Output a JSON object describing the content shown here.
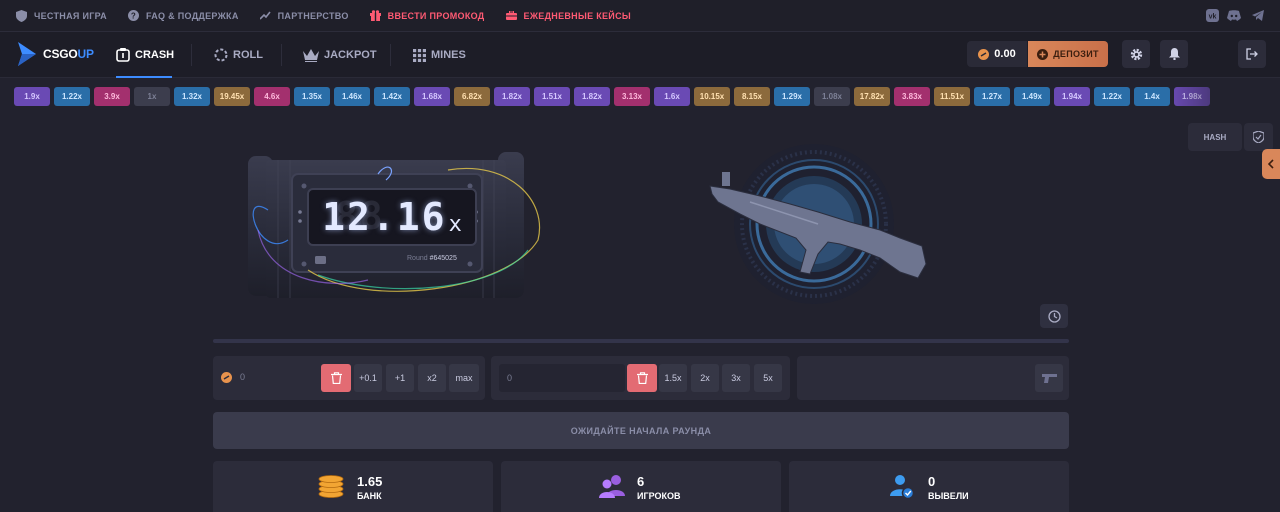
{
  "topbar": {
    "links": [
      {
        "label": "ЧЕСТНАЯ ИГРА",
        "icon": "shield-icon"
      },
      {
        "label": "FAQ & ПОДДЕРЖКА",
        "icon": "question-icon"
      },
      {
        "label": "ПАРТНЕРСТВО",
        "icon": "trend-icon"
      },
      {
        "label": "ВВЕСТИ ПРОМОКОД",
        "icon": "gift-icon"
      },
      {
        "label": "ЕЖЕДНЕВНЫЕ КЕЙСЫ",
        "icon": "case-icon"
      }
    ],
    "socials": [
      "vk-icon",
      "discord-icon",
      "telegram-icon"
    ]
  },
  "nav": {
    "logo_main": "CSGO",
    "logo_accent": "UP",
    "tabs": [
      {
        "label": "CRASH",
        "active": true
      },
      {
        "label": "ROLL",
        "active": false
      },
      {
        "label": "JACKPOT",
        "active": false
      },
      {
        "label": "MINES",
        "active": false
      }
    ],
    "balance": "0.00",
    "deposit_label": "ДЕПОЗИТ"
  },
  "history": [
    {
      "v": "1.9x",
      "bg": "#6a4ab4",
      "fg": "#d6c8ff"
    },
    {
      "v": "1.22x",
      "bg": "#2a6ea8",
      "fg": "#cde6ff"
    },
    {
      "v": "3.9x",
      "bg": "#a3306e",
      "fg": "#ffb9dc"
    },
    {
      "v": "1x",
      "bg": "#3c3d4d",
      "fg": "#7d8096"
    },
    {
      "v": "1.32x",
      "bg": "#2a6ea8",
      "fg": "#cde6ff"
    },
    {
      "v": "19.45x",
      "bg": "#8c6a3c",
      "fg": "#ffe0b0"
    },
    {
      "v": "4.6x",
      "bg": "#a3306e",
      "fg": "#ffb9dc"
    },
    {
      "v": "1.35x",
      "bg": "#2a6ea8",
      "fg": "#cde6ff"
    },
    {
      "v": "1.46x",
      "bg": "#2a6ea8",
      "fg": "#cde6ff"
    },
    {
      "v": "1.42x",
      "bg": "#2a6ea8",
      "fg": "#cde6ff"
    },
    {
      "v": "1.68x",
      "bg": "#6a4ab4",
      "fg": "#d6c8ff"
    },
    {
      "v": "6.82x",
      "bg": "#8c6a3c",
      "fg": "#ffe0b0"
    },
    {
      "v": "1.82x",
      "bg": "#6a4ab4",
      "fg": "#d6c8ff"
    },
    {
      "v": "1.51x",
      "bg": "#6a4ab4",
      "fg": "#d6c8ff"
    },
    {
      "v": "1.82x",
      "bg": "#6a4ab4",
      "fg": "#d6c8ff"
    },
    {
      "v": "3.13x",
      "bg": "#a3306e",
      "fg": "#ffb9dc"
    },
    {
      "v": "1.6x",
      "bg": "#6a4ab4",
      "fg": "#d6c8ff"
    },
    {
      "v": "10.15x",
      "bg": "#8c6a3c",
      "fg": "#ffe0b0"
    },
    {
      "v": "8.15x",
      "bg": "#8c6a3c",
      "fg": "#ffe0b0"
    },
    {
      "v": "1.29x",
      "bg": "#2a6ea8",
      "fg": "#cde6ff"
    },
    {
      "v": "1.08x",
      "bg": "#3c3d4d",
      "fg": "#7d8096"
    },
    {
      "v": "17.82x",
      "bg": "#8c6a3c",
      "fg": "#ffe0b0"
    },
    {
      "v": "3.83x",
      "bg": "#a3306e",
      "fg": "#ffb9dc"
    },
    {
      "v": "11.51x",
      "bg": "#8c6a3c",
      "fg": "#ffe0b0"
    },
    {
      "v": "1.27x",
      "bg": "#2a6ea8",
      "fg": "#cde6ff"
    },
    {
      "v": "1.49x",
      "bg": "#2a6ea8",
      "fg": "#cde6ff"
    },
    {
      "v": "1.94x",
      "bg": "#6a4ab4",
      "fg": "#d6c8ff"
    },
    {
      "v": "1.22x",
      "bg": "#2a6ea8",
      "fg": "#cde6ff"
    },
    {
      "v": "1.4x",
      "bg": "#2a6ea8",
      "fg": "#cde6ff"
    },
    {
      "v": "1.98x",
      "bg": "#6a4ab4",
      "fg": "#d6c8ff"
    }
  ],
  "game": {
    "multiplier_ghost": "88",
    "multiplier": "12.16",
    "multiplier_suffix": "x",
    "round_label": "Round",
    "round_id": "#645025",
    "hash_label": "HASH"
  },
  "bet": {
    "amount": "0",
    "quick": [
      "+0.1",
      "+1",
      "x2",
      "max"
    ],
    "auto_value": "0",
    "auto_quick": [
      "1.5x",
      "2x",
      "3x",
      "5x"
    ]
  },
  "wait_label": "ОЖИДАЙТЕ НАЧАЛА РАУНДА",
  "stats": [
    {
      "value": "1.65",
      "label": "БАНК",
      "icon": "coins-icon"
    },
    {
      "value": "6",
      "label": "ИГРОКОВ",
      "icon": "players-icon"
    },
    {
      "value": "0",
      "label": "ВЫВЕЛИ",
      "icon": "cashed-out-icon"
    }
  ]
}
